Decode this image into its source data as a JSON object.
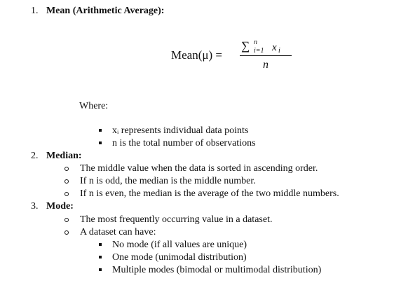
{
  "items": [
    {
      "number": "1.",
      "title": "Mean (Arithmetic Average):"
    },
    {
      "number": "2.",
      "title": "Median:"
    },
    {
      "number": "3.",
      "title": "Mode:"
    }
  ],
  "formula": {
    "lhs": "Mean(μ) =",
    "sum_symbol": "∑",
    "upper_limit": "n",
    "lower_limit": "i=1",
    "term": "x",
    "term_subscript": "i",
    "denominator": "n"
  },
  "where_label": "Where:",
  "mean_bullets": [
    "xᵢ represents individual data points",
    "n is the total number of observations"
  ],
  "median_bullets": [
    "The middle value when the data is sorted in ascending order.",
    "If n is odd, the median is the middle number.",
    "If n is even, the median is the average of the two middle numbers."
  ],
  "mode_bullets": [
    "The most frequently occurring value in a dataset.",
    "A dataset can have:"
  ],
  "mode_sub_bullets": [
    "No mode (if all values are unique)",
    "One mode (unimodal distribution)",
    "Multiple modes (bimodal or multimodal distribution)"
  ]
}
